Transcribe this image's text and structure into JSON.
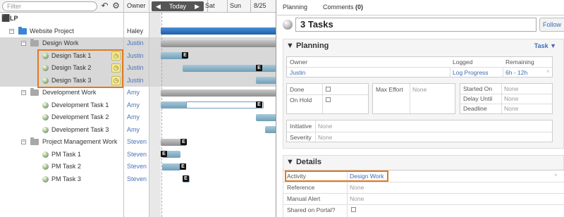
{
  "left": {
    "filter_placeholder": "Filter",
    "owner_header": "Owner",
    "gantt": {
      "today_label": "Today",
      "prev_arrow": "◀",
      "next_arrow": "▶",
      "days": [
        "Sat",
        "Sun",
        "8/25"
      ]
    },
    "tree": [
      {
        "label": "LP",
        "type": "root",
        "owner": ""
      },
      {
        "label": "Website Project",
        "type": "project",
        "owner": "Haley"
      },
      {
        "label": "Design Work",
        "type": "group",
        "owner": "Justin"
      },
      {
        "label": "Design Task 1",
        "type": "task",
        "owner": "Justin"
      },
      {
        "label": "Design Task 2",
        "type": "task",
        "owner": "Justin"
      },
      {
        "label": "Design Task 3",
        "type": "task",
        "owner": "Justin"
      },
      {
        "label": "Development Work",
        "type": "group",
        "owner": "Amy"
      },
      {
        "label": "Development Task 1",
        "type": "task",
        "owner": "Amy"
      },
      {
        "label": "Development Task 2",
        "type": "task",
        "owner": "Amy"
      },
      {
        "label": "Development Task 3",
        "type": "task",
        "owner": "Amy"
      },
      {
        "label": "Project Management Work",
        "type": "group",
        "owner": "Steven"
      },
      {
        "label": "PM Task 1",
        "type": "task",
        "owner": "Steven"
      },
      {
        "label": "PM Task 2",
        "type": "task",
        "owner": "Steven"
      },
      {
        "label": "PM Task 3",
        "type": "task",
        "owner": "Steven"
      }
    ],
    "e_marker": "E"
  },
  "right": {
    "tabs": {
      "planning": "Planning",
      "comments": "Comments",
      "comments_count": "(0)"
    },
    "title": "3 Tasks",
    "follow_label": "Follow",
    "planning": {
      "heading": "▼ Planning",
      "task_link": "Task ▼",
      "cols": {
        "owner": "Owner",
        "logged": "Logged",
        "remaining": "Remaining"
      },
      "owner_value": "Justin",
      "logged_value": "Log Progress",
      "remaining_value": "6h - 12h",
      "clear_x": "×",
      "done": "Done",
      "on_hold": "On Hold",
      "max_effort": "Max Effort",
      "max_effort_value": "None",
      "started_on": "Started On",
      "started_on_value": "None",
      "delay_until": "Delay Until",
      "delay_until_value": "None",
      "deadline": "Deadline",
      "deadline_value": "None",
      "initiative": "Initiative",
      "initiative_value": "None",
      "severity": "Severity",
      "severity_value": "None"
    },
    "details": {
      "heading": "▼ Details",
      "activity": "Activity",
      "activity_value": "Design Work",
      "reference": "Reference",
      "reference_value": "None",
      "manual_alert": "Manual Alert",
      "manual_alert_value": "None",
      "shared_on_portal": "Shared on Portal?"
    }
  },
  "colors": {
    "highlight": "#e07a1f",
    "link": "#3b6cb5",
    "project_bar": "#1d5ea8"
  }
}
